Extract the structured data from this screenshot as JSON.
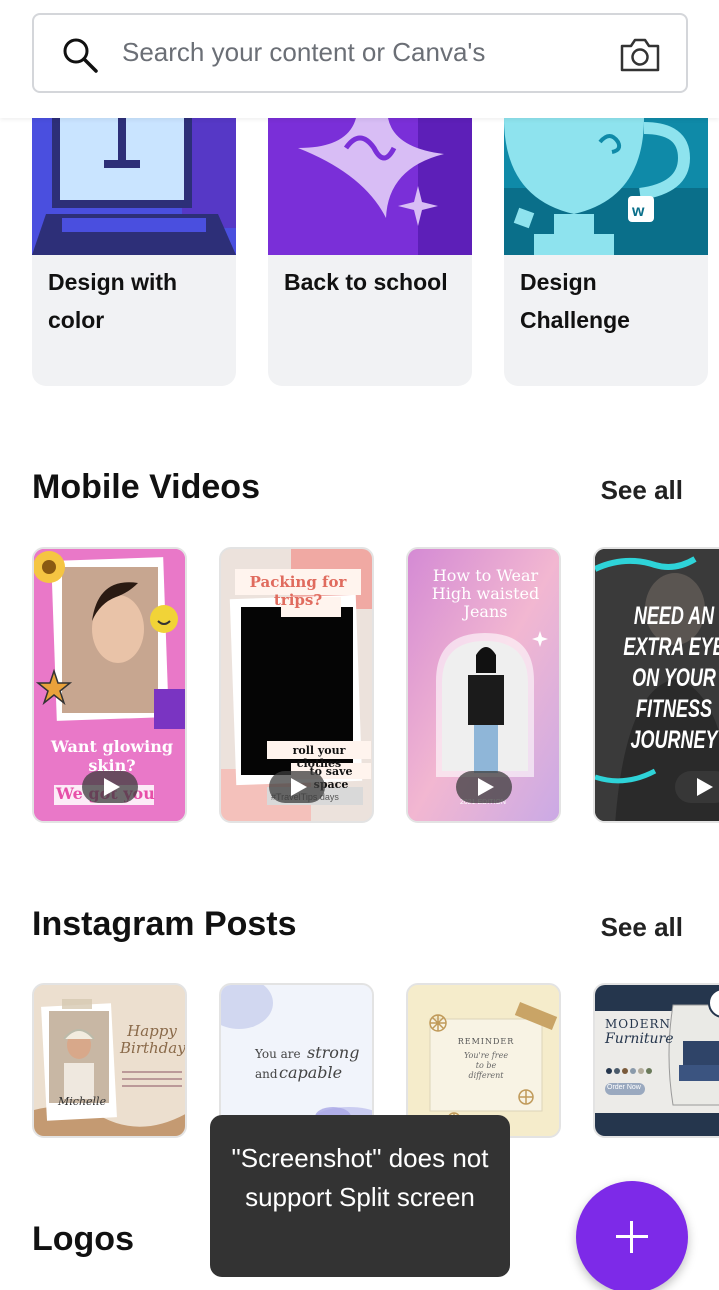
{
  "search": {
    "placeholder": "Search your content or Canva's"
  },
  "features": [
    {
      "title": "Design with color"
    },
    {
      "title": "Back to school"
    },
    {
      "title": "Design Challenge"
    }
  ],
  "mobile_videos": {
    "title": "Mobile Videos",
    "see_all": "See all",
    "cards": [
      {
        "text1": "Want glowing skin?",
        "text2": "We got you"
      },
      {
        "text1": "Packing for trips?",
        "text2": "roll your clothes",
        "text3": "to save space",
        "text4": "#TravelTips days"
      },
      {
        "text1": "How to Wear High waisted Jeans",
        "text2": "2021 EDITION"
      },
      {
        "text1": "NEED AN EXTRA EYE ON YOUR FITNESS JOURNEY"
      }
    ]
  },
  "instagram_posts": {
    "title": "Instagram Posts",
    "see_all": "See all",
    "cards": [
      {
        "text1": "Happy Birthday",
        "text2": "Michelle"
      },
      {
        "text1": "You are",
        "text2": "strong",
        "text3": "and",
        "text4": "capable"
      },
      {
        "text1": "REMINDER",
        "text2": "You're free to be different"
      },
      {
        "text1": "MODERN",
        "text2": "Furniture",
        "text3": "Order Now"
      }
    ]
  },
  "logos": {
    "title": "Logos"
  },
  "toast": {
    "message": "\"Screenshot\" does not support Split screen"
  },
  "colors": {
    "accent": "#7d2ae8",
    "toast_bg": "#333333",
    "card_bg": "#f1f2f4"
  }
}
